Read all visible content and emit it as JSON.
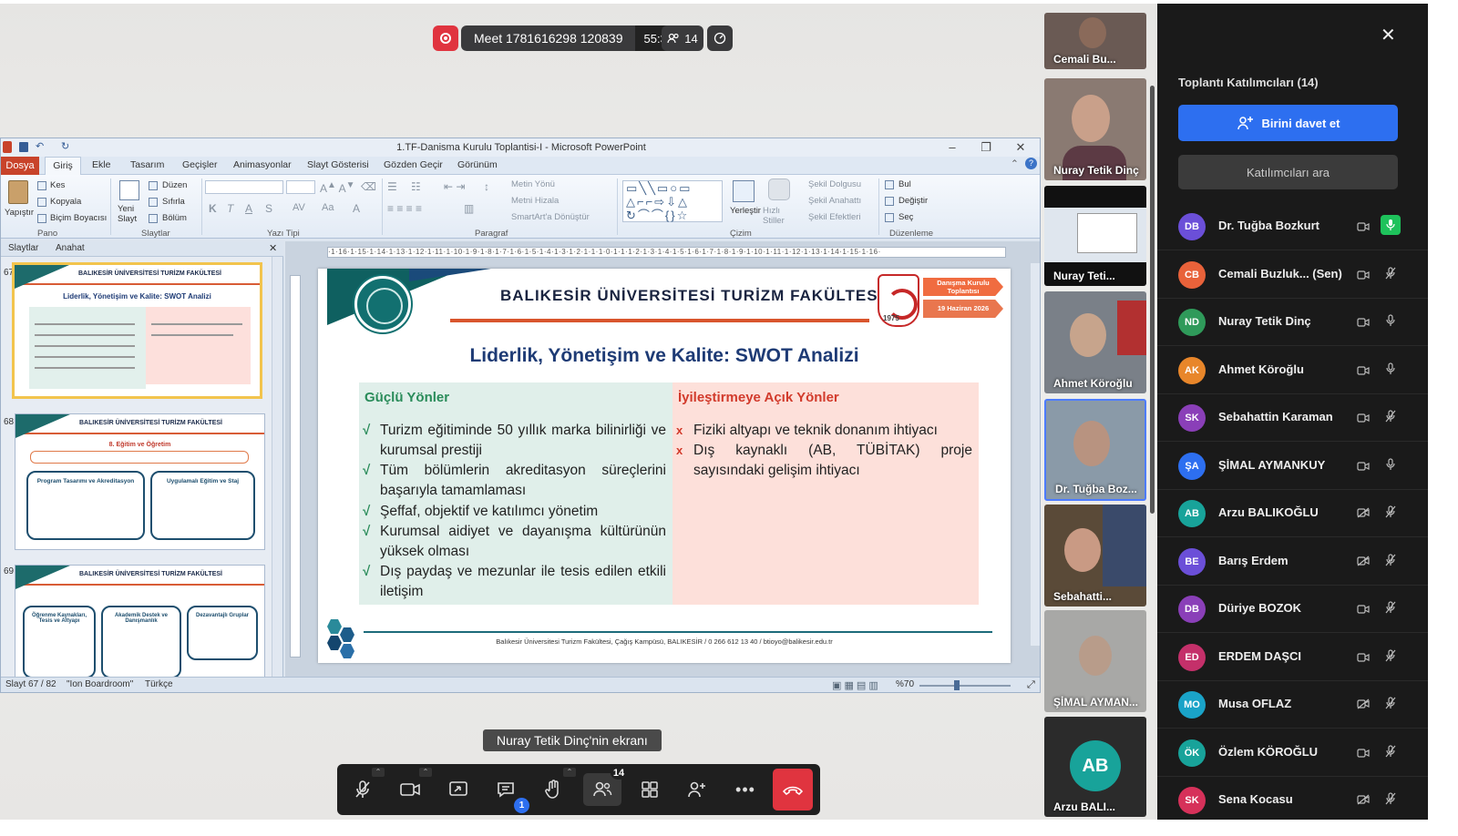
{
  "meeting": {
    "name": "Meet 1781616298 120839",
    "timer": "55:31",
    "participants": "14"
  },
  "window": {
    "title": "1.TF-Danisma Kurulu Toplantisi-I - Microsoft PowerPoint"
  },
  "menu": {
    "file": "Dosya",
    "tabs": [
      "Giriş",
      "Ekle",
      "Tasarım",
      "Geçişler",
      "Animasyonlar",
      "Slayt Gösterisi",
      "Gözden Geçir",
      "Görünüm"
    ]
  },
  "ribbon": {
    "paste": "Yapıştır",
    "cut": "Kes",
    "copy": "Kopyala",
    "format_painter": "Biçim Boyacısı",
    "new_slide": "Yeni Slayt",
    "layout": "Düzen",
    "reset": "Sıfırla",
    "section": "Bölüm",
    "text_direction": "Metin Yönü",
    "align_text": "Metni Hizala",
    "smartart": "SmartArt'a Dönüştür",
    "arrange": "Yerleştir",
    "quick_styles": "Hızlı Stiller",
    "shape_fill": "Şekil Dolgusu",
    "shape_outline": "Şekil Anahattı",
    "shape_effects": "Şekil Efektleri",
    "find": "Bul",
    "replace": "Değiştir",
    "select": "Seç",
    "groups": [
      "Pano",
      "Slaytlar",
      "Yazı Tipi",
      "Paragraf",
      "Çizim",
      "Düzenleme"
    ]
  },
  "panes": {
    "slides": "Slaytlar",
    "outline": "Anahat"
  },
  "thumbs": [
    {
      "num": "67",
      "header": "BALIKESİR ÜNİVERSİTESİ TURİZM FAKÜLTESİ",
      "title": "Liderlik, Yönetişim ve Kalite: SWOT Analizi"
    },
    {
      "num": "68",
      "header": "BALIKESİR ÜNİVERSİTESİ TURİZM FAKÜLTESİ",
      "title": "8. Eğitim ve Öğretim",
      "b1": "Program Tasarımı ve Akreditasyon",
      "b2": "Uygulamalı Eğitim ve Staj"
    },
    {
      "num": "69",
      "header": "BALIKESİR ÜNİVERSİTESİ TURİZM FAKÜLTESİ",
      "b1": "Öğrenme Kaynakları, Tesis ve Altyapı",
      "b2": "Akademik Destek ve Danışmanlık",
      "b3": "Dezavantajlı Gruplar"
    }
  ],
  "ruler": "·1·16·1·15·1·14·1·13·1·12·1·11·1·10·1·9·1·8·1·7·1·6·1·5·1·4·1·3·1·2·1·1·1·0·1·1·1·2·1·3·1·4·1·5·1·6·1·7·1·8·1·9·1·10·1·11·1·12·1·13·1·14·1·15·1·16·",
  "slide": {
    "header": "BALIKESİR ÜNİVERSİTESİ TURİZM FAKÜLTESİ",
    "badge1": "Danışma Kurulu Toplantısı",
    "badge2": "19 Haziran 2026",
    "seal_year": "1975",
    "title": "Liderlik, Yönetişim ve Kalite: SWOT Analizi",
    "strengths_title": "Güçlü Yönler",
    "strengths": [
      "Turizm eğitiminde 50 yıllık marka bilinirliği ve kurumsal prestiji",
      "Tüm bölümlerin akreditasyon süreçlerini başarıyla tamamlaması",
      "Şeffaf, objektif ve katılımcı yönetim",
      "Kurumsal aidiyet ve dayanışma kültürünün yüksek olması",
      "Dış paydaş ve mezunlar ile tesis edilen etkili iletişim"
    ],
    "weak_title": "İyileştirmeye Açık Yönler",
    "weaknesses": [
      "Fiziki altyapı ve teknik donanım ihtiyacı",
      "Dış kaynaklı (AB, TÜBİTAK) proje sayısındaki gelişim ihtiyacı"
    ],
    "footer": "Balıkesir Üniversitesi Turizm Fakültesi, Çağış Kampüsü, BALIKESİR / 0 266 612 13 40 / btioyo@balikesir.edu.tr"
  },
  "status": {
    "slide": "Slayt 67 / 82",
    "theme": "\"Ion Boardroom\"",
    "lang": "Türkçe",
    "zoom": "%70"
  },
  "tiles": [
    "Cemali Bu...",
    "Nuray Tetik Dinç",
    "Nuray Teti...",
    "Ahmet Köroğlu",
    "Dr. Tuğba Boz...",
    "Sebahatti...",
    "ŞİMAL AYMAN...",
    "Arzu BALI..."
  ],
  "tile_avatar": "AB",
  "share_label": "Nuray Tetik Dinç'nin ekranı",
  "toolbar": {
    "participants_badge": "14",
    "chat_badge": "1"
  },
  "panel": {
    "title": "Toplantı Katılımcıları (14)",
    "invite": "Birini davet et",
    "search": "Katılımcıları ara",
    "people": [
      {
        "initials": "DB",
        "name": "Dr. Tuğba Bozkurt",
        "color": "#6b4fd8",
        "cam": "on",
        "mic": "speaking"
      },
      {
        "initials": "CB",
        "name": "Cemali Buzluk... (Sen)",
        "color": "#e8623a",
        "cam": "on",
        "mic": "muted"
      },
      {
        "initials": "ND",
        "name": "Nuray Tetik Dinç",
        "color": "#2f9a5a",
        "cam": "on",
        "mic": "on"
      },
      {
        "initials": "AK",
        "name": "Ahmet Köroğlu",
        "color": "#e8862a",
        "cam": "on",
        "mic": "on"
      },
      {
        "initials": "SK",
        "name": "Sebahattin Karaman",
        "color": "#8a3fb8",
        "cam": "on",
        "mic": "muted"
      },
      {
        "initials": "ŞA",
        "name": "ŞİMAL AYMANKUY",
        "color": "#2d6ff0",
        "cam": "on",
        "mic": "on"
      },
      {
        "initials": "AB",
        "name": "Arzu BALIKOĞLU",
        "color": "#18a39a",
        "cam": "off",
        "mic": "muted"
      },
      {
        "initials": "BE",
        "name": "Barış Erdem",
        "color": "#6b4fd8",
        "cam": "off",
        "mic": "muted"
      },
      {
        "initials": "DB",
        "name": "Düriye BOZOK",
        "color": "#8a3fb8",
        "cam": "on",
        "mic": "muted"
      },
      {
        "initials": "ED",
        "name": "ERDEM DAŞCI",
        "color": "#c4306a",
        "cam": "on",
        "mic": "muted"
      },
      {
        "initials": "MO",
        "name": "Musa OFLAZ",
        "color": "#1aa3c8",
        "cam": "off",
        "mic": "muted"
      },
      {
        "initials": "ÖK",
        "name": "Özlem KÖROĞLU",
        "color": "#18a39a",
        "cam": "on",
        "mic": "muted"
      },
      {
        "initials": "SK",
        "name": "Sena Kocasu",
        "color": "#d6315a",
        "cam": "off",
        "mic": "muted"
      }
    ]
  }
}
